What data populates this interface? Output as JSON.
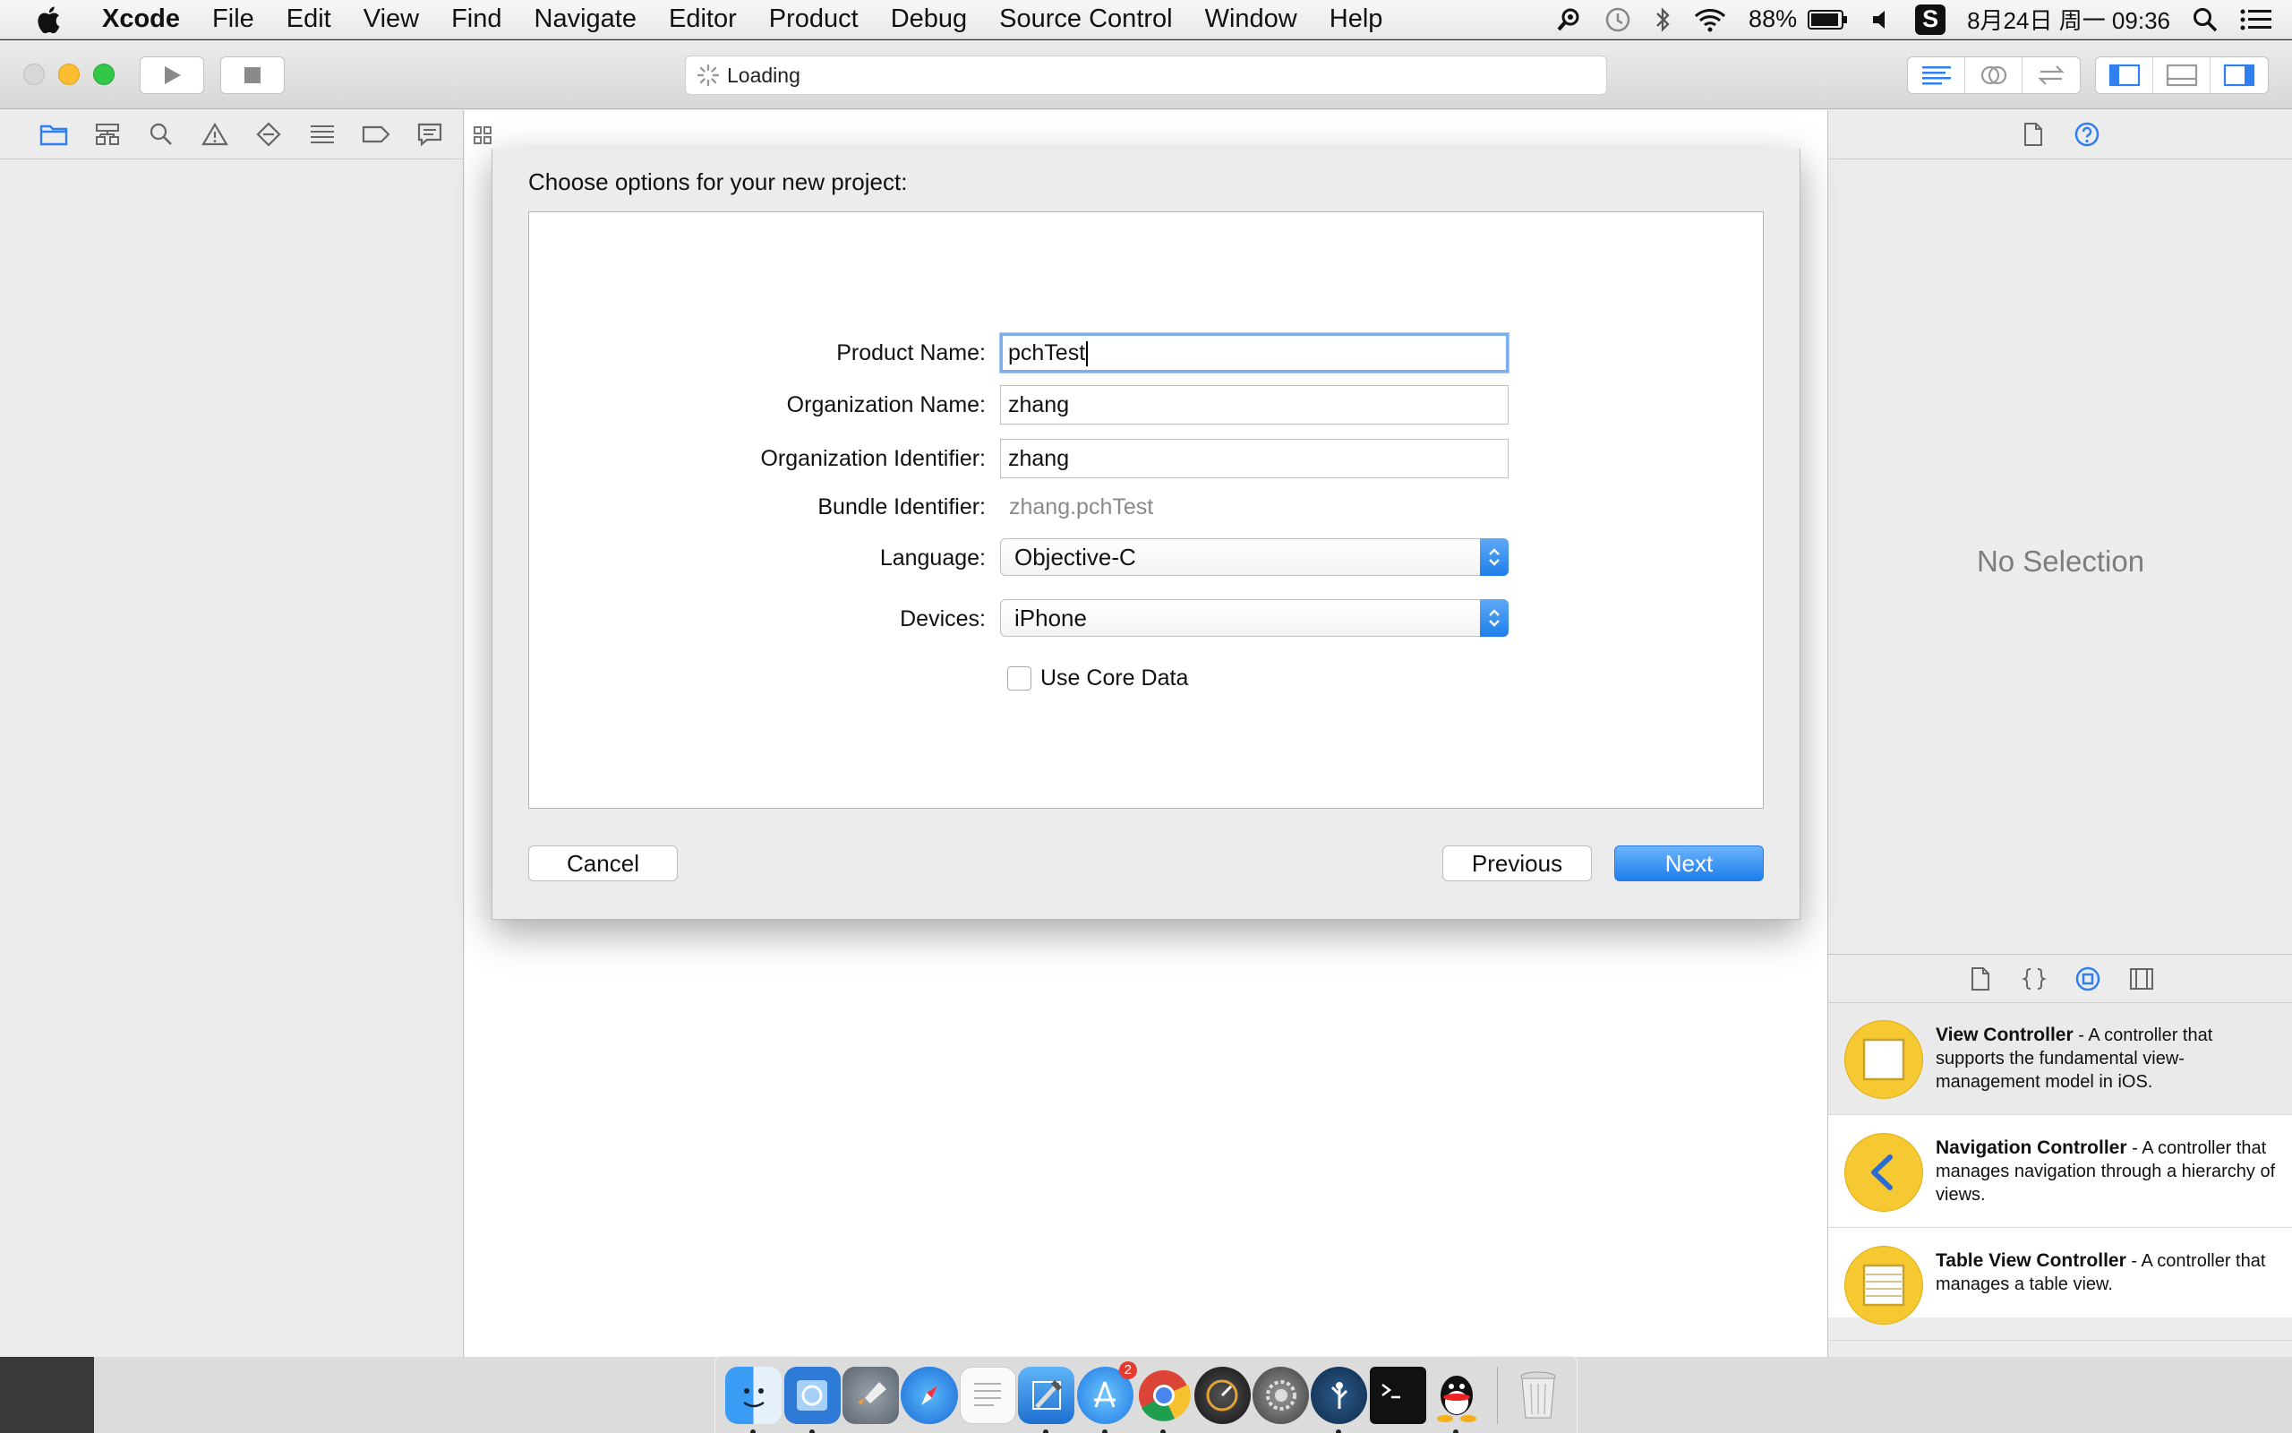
{
  "menubar": {
    "app_name": "Xcode",
    "items": [
      "File",
      "Edit",
      "View",
      "Find",
      "Navigate",
      "Editor",
      "Product",
      "Debug",
      "Source Control",
      "Window",
      "Help"
    ],
    "battery": "88%",
    "input_method": "S",
    "datetime": "8月24日 周一  09:36"
  },
  "toolbar": {
    "activity_text": "Loading"
  },
  "sheet": {
    "title": "Choose options for your new project:",
    "fields": {
      "product_name_label": "Product Name:",
      "product_name_value": "pchTest",
      "org_name_label": "Organization Name:",
      "org_name_value": "zhang",
      "org_id_label": "Organization Identifier:",
      "org_id_value": "zhang",
      "bundle_id_label": "Bundle Identifier:",
      "bundle_id_value": "zhang.pchTest",
      "language_label": "Language:",
      "language_value": "Objective-C",
      "devices_label": "Devices:",
      "devices_value": "iPhone",
      "core_data_label": "Use Core Data"
    },
    "buttons": {
      "cancel": "Cancel",
      "previous": "Previous",
      "next": "Next"
    }
  },
  "inspector": {
    "empty_text": "No Selection"
  },
  "library": {
    "items": [
      {
        "title": "View Controller",
        "desc": " - A controller that supports the fundamental view-management model in iOS."
      },
      {
        "title": "Navigation Controller",
        "desc": " - A controller that manages navigation through a hierarchy of views."
      },
      {
        "title": "Table View Controller",
        "desc": " - A controller that manages a table view."
      }
    ]
  },
  "dock": {
    "appstore_badge": "2"
  },
  "colors": {
    "accent_blue": "#1c7eee",
    "focus_ring": "#7aaeed",
    "library_icon_yellow": "#f6c933"
  }
}
